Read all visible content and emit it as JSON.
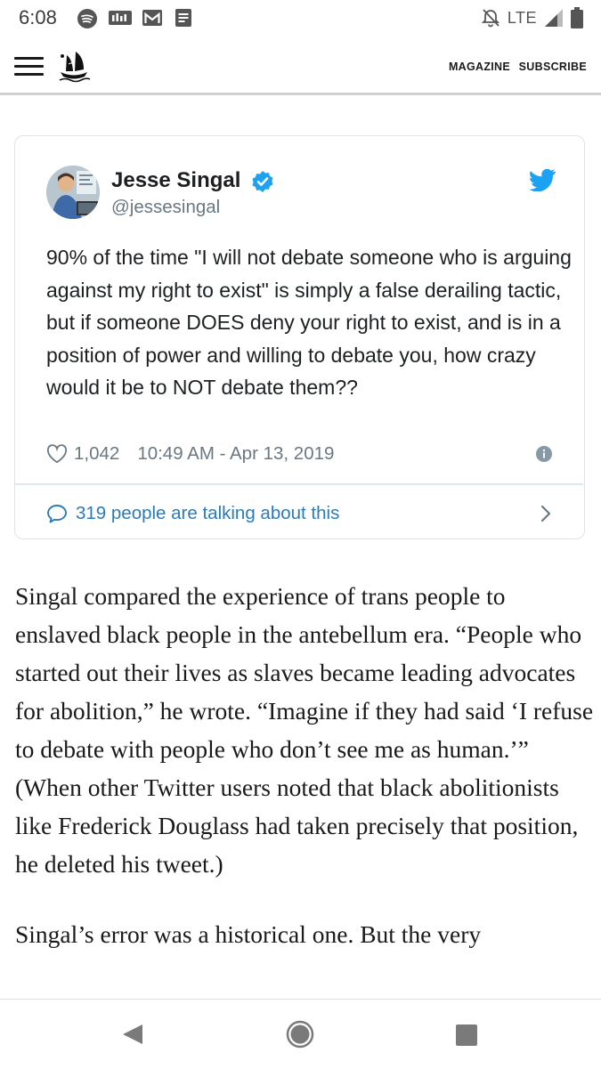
{
  "status_bar": {
    "time": "6:08",
    "network": "LTE",
    "icons": [
      "spotify-icon",
      "tidal-icon",
      "gmail-icon",
      "docs-icon",
      "dnd-off-icon",
      "signal-icon",
      "battery-icon"
    ]
  },
  "header": {
    "menu_icon": "hamburger-icon",
    "logo_icon": "ship-logo-icon",
    "links": [
      "MAGAZINE",
      "SUBSCRIBE"
    ]
  },
  "tweet": {
    "author_name": "Jesse Singal",
    "handle": "@jessesingal",
    "text": "90% of the time \"I will not debate someone who is arguing against my right to exist\" is simply a false derailing tactic, but if someone DOES deny your right to exist, and is in a position of power and willing to debate you, how crazy would it be to NOT debate them??",
    "likes": "1,042",
    "timestamp": "10:49 AM - Apr 13, 2019",
    "talking": "319 people are talking about this",
    "colors": {
      "link": "#2b7bb9",
      "verified": "#1da1f2",
      "twitter": "#1da1f2",
      "muted": "#697882"
    }
  },
  "article": {
    "paragraphs": [
      "Singal compared the experience of trans people to enslaved black people in the antebellum era. “People who started out their lives as slaves became leading advocates for abolition,” he wrote. “Imagine if they had said ‘I refuse to debate with people who don’t see me as human.’” (When other Twitter users noted that black abolitionists like Frederick Douglass had taken precisely that position, he deleted his tweet.)",
      "Singal’s error was a historical one. But the very"
    ]
  },
  "nav_bar": {
    "icons": [
      "back-icon",
      "home-icon",
      "recents-icon"
    ]
  }
}
